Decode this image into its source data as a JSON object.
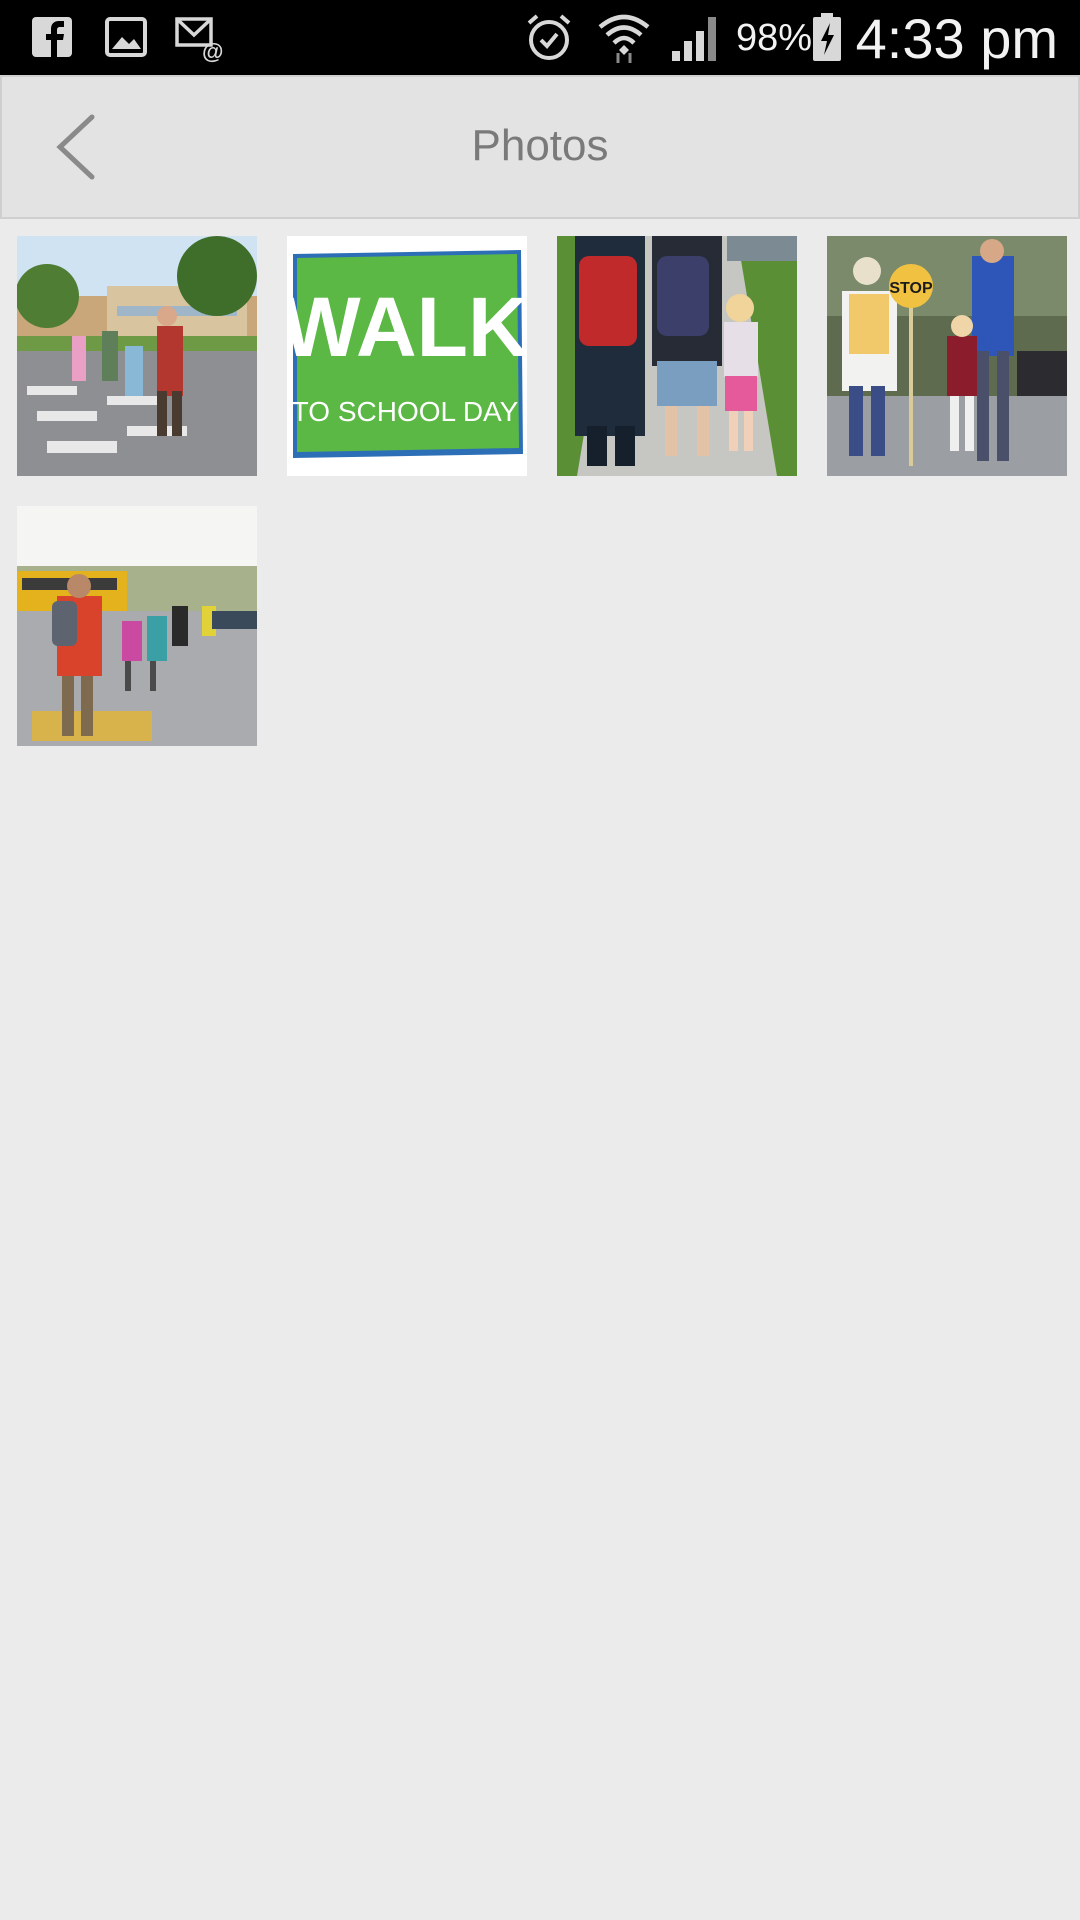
{
  "status_bar": {
    "battery_percent": "98%",
    "time": "4:33 pm",
    "icons": [
      "facebook-icon",
      "gallery-icon",
      "email-icon",
      "alarm-icon",
      "wifi-icon",
      "signal-icon",
      "battery-charging-icon"
    ]
  },
  "header": {
    "title": "Photos",
    "back_icon": "chevron-left-icon"
  },
  "photos": [
    {
      "name": "photo-kids-crosswalk",
      "alt": "Children crossing street with backpacks"
    },
    {
      "name": "photo-walk-to-school-day",
      "alt": "Walk to School Day logo",
      "logo_text_top": "WALK",
      "logo_text_bottom": "TO SCHOOL DAY"
    },
    {
      "name": "photo-kids-backpacks-sidewalk",
      "alt": "Children walking on sidewalk with backpacks"
    },
    {
      "name": "photo-crossing-guard",
      "alt": "Crossing guard with stop sign",
      "sign_text": "STOP"
    },
    {
      "name": "photo-kids-school-bus",
      "alt": "Children walking near school bus"
    }
  ],
  "colors": {
    "background": "#ebebeb",
    "header_bg": "#e3e3e3",
    "title": "#7a7a7a",
    "logo_green": "#5bb845"
  }
}
